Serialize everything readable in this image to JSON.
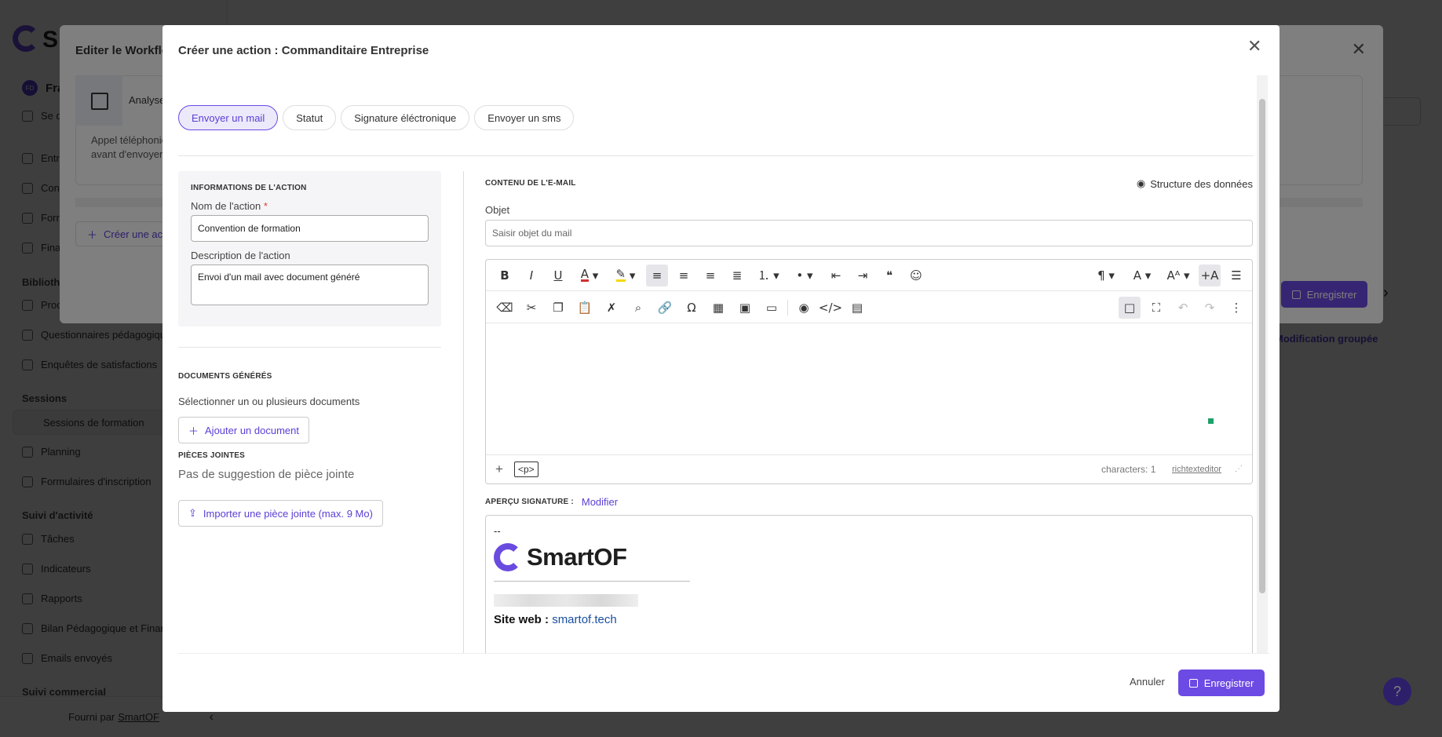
{
  "app": {
    "logo_text": "Sm",
    "footer_provided_by": "Fourni par",
    "footer_brand": "SmartOF",
    "sidebar": {
      "org_initials": "FD",
      "org_name": "Fra",
      "logout": "Se d",
      "items_top": [
        "Entr",
        "Con",
        "Forr",
        "Fina"
      ],
      "section_library": "Bibliothè",
      "library_items": [
        "Proc",
        "Questionnaires pédagogiques",
        "Enquêtes de satisfactions"
      ],
      "section_sessions": "Sessions",
      "session_items": [
        "Sessions de formation",
        "Planning",
        "Formulaires d'inscription"
      ],
      "section_activity": "Suivi d'activité",
      "activity_items": [
        "Tâches",
        "Indicateurs",
        "Rapports",
        "Bilan Pédagogique et Finan",
        "Emails envoyés"
      ],
      "section_commercial": "Suivi commercial"
    },
    "background": {
      "modification_groupee": "Modification groupée"
    }
  },
  "workflow_modal": {
    "title": "Editer le Workflo",
    "card_title": "Analyse",
    "card_desc_line1": "Appel téléphonic",
    "card_desc_line2": "avant d'envoyer",
    "create_action": "Créer une acti",
    "save": "Enregistrer"
  },
  "action_modal": {
    "title": "Créer une action : Commanditaire Entreprise",
    "action_types": [
      "Envoyer un mail",
      "Statut",
      "Signature éléctronique",
      "Envoyer un sms"
    ],
    "active_type": "Envoyer un mail",
    "info_section": "Informations de l'action",
    "name_label": "Nom de l'action",
    "name_required": "*",
    "name_value": "Convention de formation",
    "desc_label": "Description de l'action",
    "desc_value": "Envoi d'un mail avec document généré",
    "docs_section": "Documents générés",
    "docs_hint": "Sélectionner un ou plusieurs documents",
    "add_document": "Ajouter un document",
    "attachments_section": "Pièces jointes",
    "no_attachment": "Pas de suggestion de pièce jointe",
    "import_attachment": "Importer une pièce jointe (max. 9 Mo)",
    "content_section": "Contenu de l'e-mail",
    "data_structure": "Structure des données",
    "subject_label": "Objet",
    "subject_placeholder": "Saisir objet du mail",
    "editor": {
      "tag": "<p>",
      "characters": "characters: 1",
      "brand": "richtexteditor"
    },
    "signature_label": "Aperçu signature :",
    "signature_modify": "Modifier",
    "signature": {
      "dashes": "--",
      "logo_text": "SmartOF",
      "web_label": "Site web :",
      "web_url": "smartof.tech"
    },
    "cancel": "Annuler",
    "save": "Enregistrer"
  },
  "colors": {
    "accent": "#6c4ae4",
    "accent_text": "#5b3fd4"
  }
}
